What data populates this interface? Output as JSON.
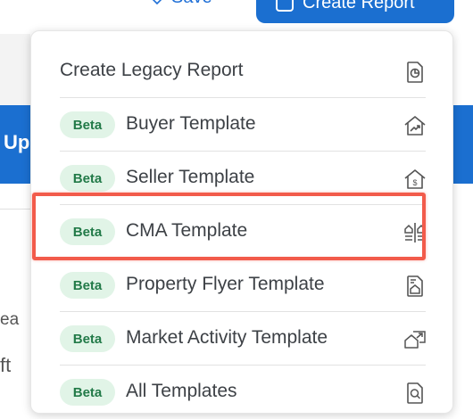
{
  "background": {
    "save_label": "Save",
    "create_report_label": "Create Report",
    "band_text": "Upd",
    "side_text_1": "ea",
    "side_text_2": "ft"
  },
  "menu": {
    "items": [
      {
        "label": "Create Legacy Report",
        "badge": "",
        "icon": "report-icon"
      },
      {
        "label": "Buyer Template",
        "badge": "Beta",
        "icon": "house-trend-icon"
      },
      {
        "label": "Seller Template",
        "badge": "Beta",
        "icon": "house-dollar-icon"
      },
      {
        "label": "CMA Template",
        "badge": "Beta",
        "icon": "compare-houses-icon"
      },
      {
        "label": "Property Flyer Template",
        "badge": "Beta",
        "icon": "flyer-icon"
      },
      {
        "label": "Market Activity Template",
        "badge": "Beta",
        "icon": "market-activity-icon"
      },
      {
        "label": "All Templates",
        "badge": "Beta",
        "icon": "search-document-icon"
      }
    ],
    "highlighted_item": "CMA Template"
  },
  "colors": {
    "primary": "#1b6fd0",
    "badge_bg": "#e1f4e7",
    "badge_text": "#227a48",
    "highlight": "#f25b4b"
  }
}
